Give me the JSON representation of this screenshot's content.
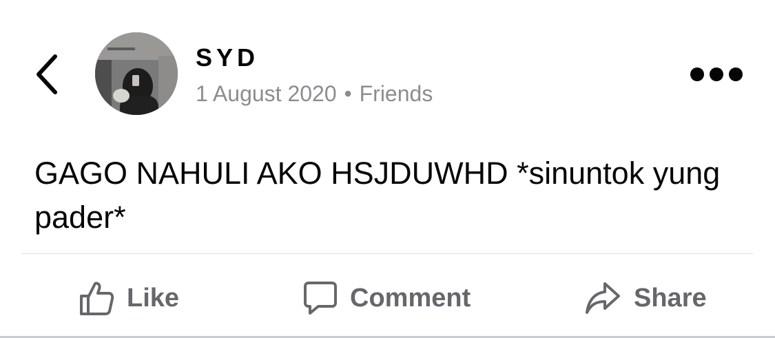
{
  "post": {
    "author": "SYD",
    "date": "1 August 2020",
    "separator": "•",
    "audience": "Friends",
    "text": "GAGO NAHULI AKO HSJDUWHD *sinuntok yung pader*"
  },
  "actions": {
    "like_label": "Like",
    "comment_label": "Comment",
    "share_label": "Share"
  },
  "icons": {
    "back": "chevron-left-icon",
    "more": "more-horizontal-icon",
    "like": "thumbs-up-icon",
    "comment": "comment-bubble-icon",
    "share": "share-arrow-icon"
  },
  "colors": {
    "text": "#050505",
    "secondary_text": "#8a8d91",
    "action_text": "#65676b",
    "divider": "#dadde1"
  }
}
